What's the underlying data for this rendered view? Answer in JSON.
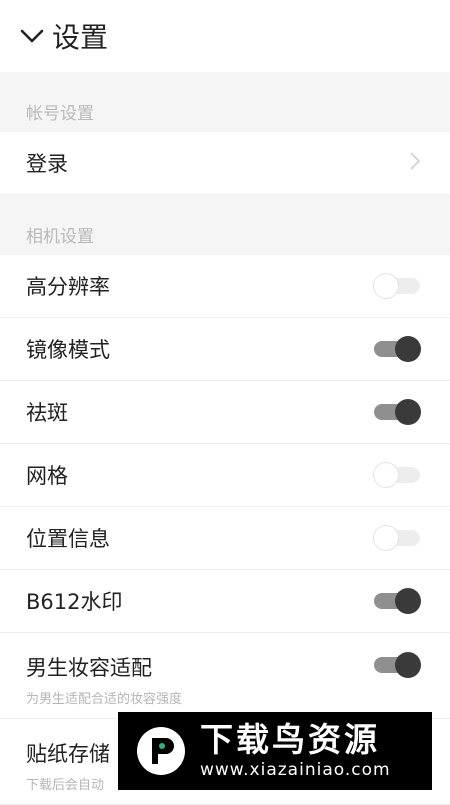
{
  "header": {
    "title": "设置",
    "back_icon": "chevron-down-icon"
  },
  "sections": {
    "account": {
      "header": "帐号设置",
      "login": {
        "label": "登录",
        "icon": "chevron-right-icon"
      }
    },
    "camera": {
      "header": "相机设置",
      "items": [
        {
          "label": "高分辨率",
          "on": false
        },
        {
          "label": "镜像模式",
          "on": true
        },
        {
          "label": "祛斑",
          "on": true
        },
        {
          "label": "网格",
          "on": false
        },
        {
          "label": "位置信息",
          "on": false
        },
        {
          "label": "B612水印",
          "on": true
        },
        {
          "label": "男生妆容适配",
          "sub": "为男生适配合适的妆容强度",
          "on": true
        },
        {
          "label": "贴纸存储",
          "sub": "下载后会自动",
          "on": false
        }
      ]
    }
  },
  "watermark": {
    "brand": "下载鸟资源",
    "domain": "www.xiazainiao.com"
  },
  "colors": {
    "toggle_on_knob": "#3a3a3a",
    "toggle_on_track": "#8f8f8f",
    "section_bg": "#f5f5f5"
  }
}
